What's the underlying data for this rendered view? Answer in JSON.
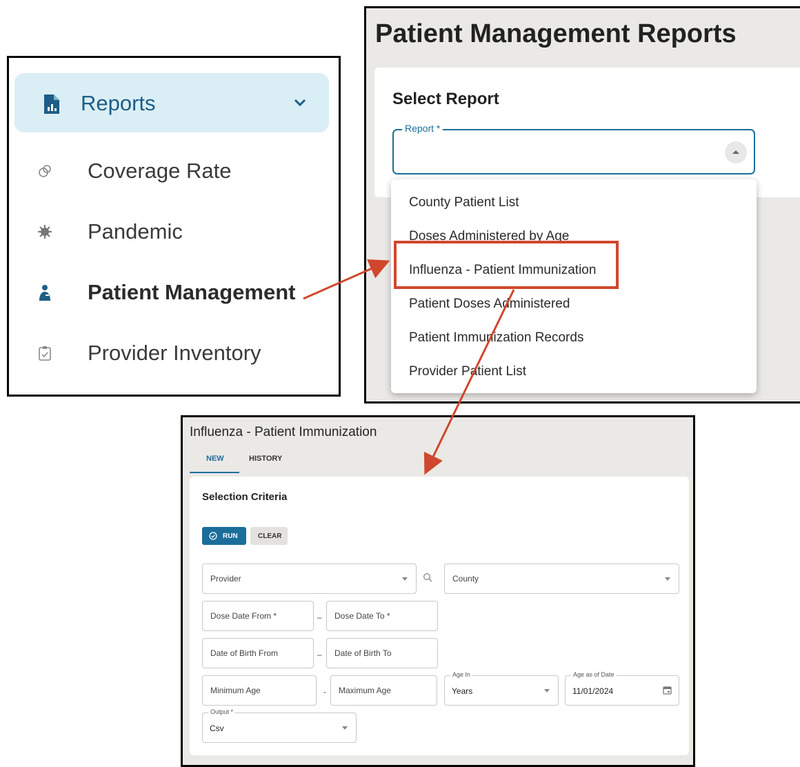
{
  "sidebar": {
    "reports_label": "Reports",
    "items": [
      {
        "label": "Coverage Rate",
        "icon": "coverage-icon"
      },
      {
        "label": "Pandemic",
        "icon": "virus-icon"
      },
      {
        "label": "Patient Management",
        "icon": "patient-icon"
      },
      {
        "label": "Provider Inventory",
        "icon": "clipboard-icon"
      }
    ]
  },
  "reports_page": {
    "title": "Patient Management Reports",
    "select_title": "Select Report",
    "report_label": "Report *",
    "options": [
      "County Patient List",
      "Doses Administered by Age",
      "Influenza - Patient Immunization",
      "Patient Doses Administered",
      "Patient Immunization Records",
      "Provider Patient List"
    ]
  },
  "form": {
    "title": "Influenza - Patient Immunization",
    "tabs": [
      "NEW",
      "HISTORY"
    ],
    "section_title": "Selection Criteria",
    "run_label": "RUN",
    "clear_label": "CLEAR",
    "provider_placeholder": "Provider",
    "county_placeholder": "County",
    "dose_date_from": "Dose Date From *",
    "dose_date_to": "Dose Date To *",
    "dob_from": "Date of Birth From",
    "dob_to": "Date of Birth To",
    "min_age": "Minimum Age",
    "max_age": "Maximum Age",
    "age_in_label": "Age In",
    "age_in_value": "Years",
    "age_as_of_label": "Age as of Date",
    "age_as_of_value": "11/01/2024",
    "output_label": "Output *",
    "output_value": "Csv",
    "range_separator_1": "–",
    "range_separator_2": "–",
    "range_separator_3": "-"
  },
  "colors": {
    "accent": "#1b6e9b",
    "highlight": "#d0472d",
    "reports_bg": "#daeef5",
    "panel_bg": "#ebe9e6"
  }
}
